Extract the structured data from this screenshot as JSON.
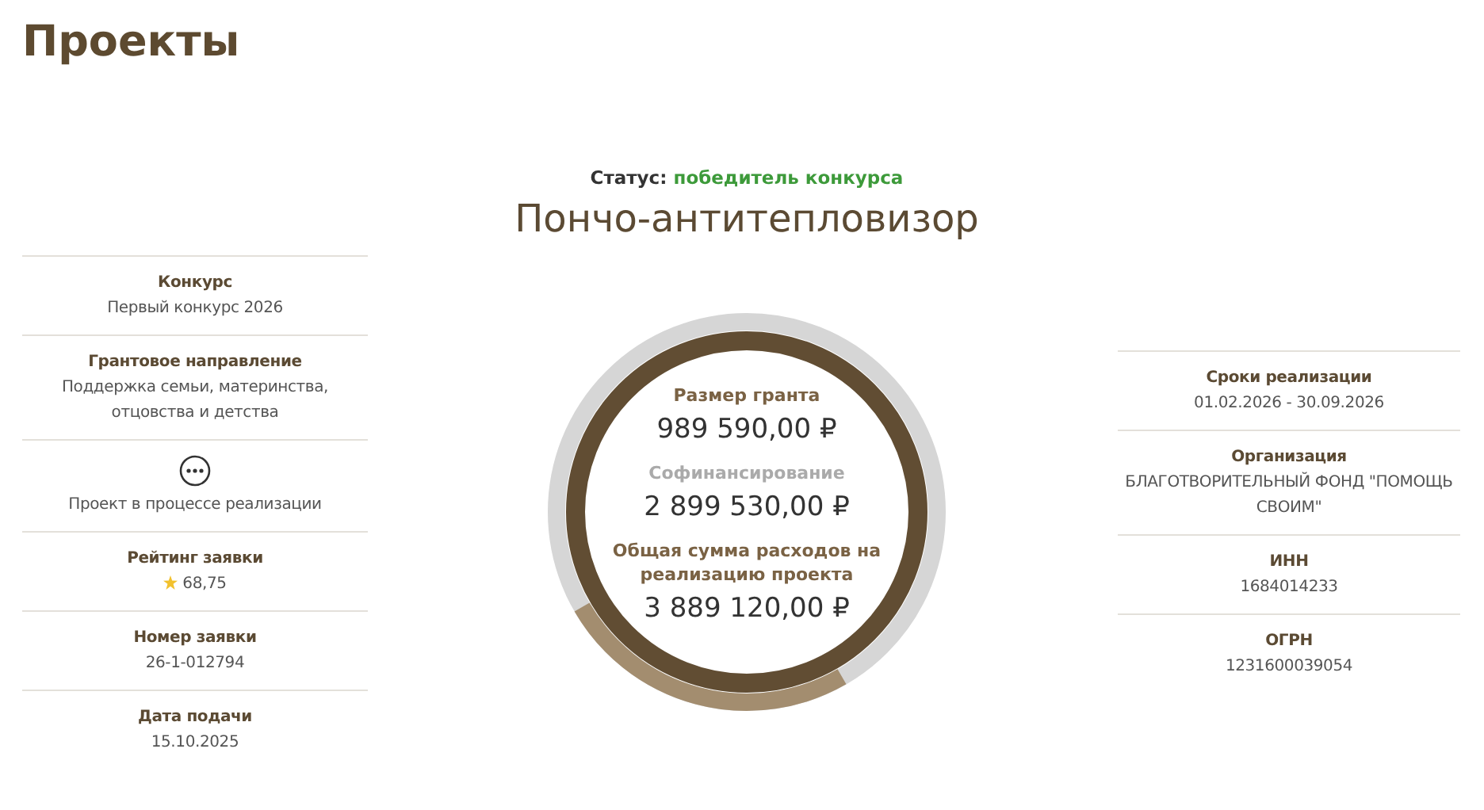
{
  "page_title": "Проекты",
  "status": {
    "label": "Статус:",
    "value": "победитель конкурса"
  },
  "project_title": "Пончо-антитепловизор",
  "left_items": [
    {
      "kind": "text",
      "label": "Конкурс",
      "value": "Первый конкурс 2026"
    },
    {
      "kind": "text",
      "label": "Грантовое направление",
      "value": "Поддержка семьи, материнства, отцовства и детства"
    },
    {
      "kind": "state",
      "value": "Проект в процессе реализации"
    },
    {
      "kind": "rating",
      "label": "Рейтинг заявки",
      "value": "68,75"
    },
    {
      "kind": "text",
      "label": "Номер заявки",
      "value": "26-1-012794"
    },
    {
      "kind": "text",
      "label": "Дата подачи",
      "value": "15.10.2025"
    }
  ],
  "ring": {
    "entries": [
      {
        "label": "Размер гранта",
        "value": "989 590,00 ₽",
        "muted": false
      },
      {
        "label": "Софинансирование",
        "value": "2 899 530,00 ₽",
        "muted": true
      },
      {
        "label": "Общая сумма расходов на реализацию проекта",
        "value": "3 889 120,00 ₽",
        "muted": false
      }
    ]
  },
  "right_items": [
    {
      "kind": "text",
      "label": "Сроки реализации",
      "value": "01.02.2026 - 30.09.2026"
    },
    {
      "kind": "text",
      "label": "Организация",
      "value": "БЛАГОТВОРИТЕЛЬНЫЙ ФОНД \"ПОМОЩЬ СВОИМ\""
    },
    {
      "kind": "text",
      "label": "ИНН",
      "value": "1684014233"
    },
    {
      "kind": "text",
      "label": "ОГРН",
      "value": "1231600039054"
    }
  ]
}
